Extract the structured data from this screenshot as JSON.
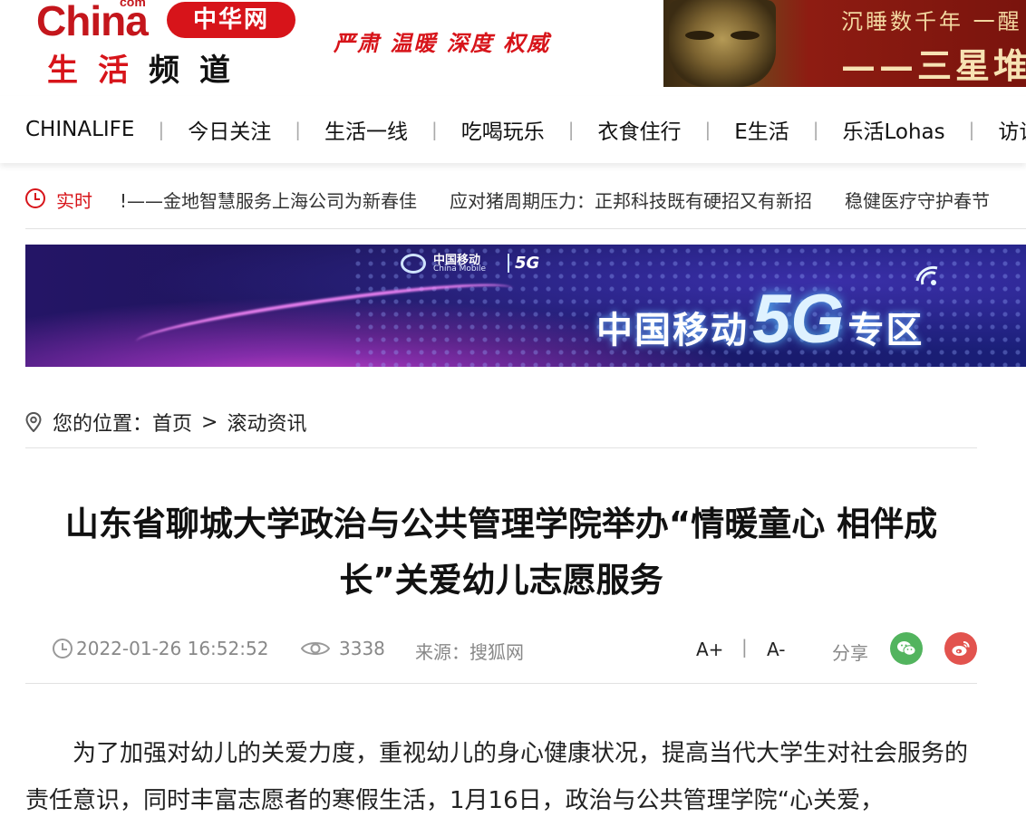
{
  "header": {
    "logo_china": "China",
    "logo_com": "com",
    "logo_badge": "中华网",
    "logo_channel": [
      "生",
      "活",
      "频",
      "道"
    ],
    "slogan": "严肃 温暖 深度 权威",
    "banner_line1": "沉睡数千年 一醒",
    "banner_line2": "——三星堆"
  },
  "nav": {
    "items": [
      "CHINALIFE",
      "今日关注",
      "生活一线",
      "吃喝玩乐",
      "衣食住行",
      "E生活",
      "乐活Lohas",
      "访谈"
    ],
    "separator": "|"
  },
  "ticker": {
    "label": "实时",
    "items": [
      "!——金地智慧服务上海公司为新春佳",
      "应对猪周期压力：正邦科技既有硬招又有新招",
      "稳健医疗守护春节"
    ]
  },
  "promo": {
    "logo_cn": "中国移动",
    "logo_en": "China Mobile",
    "logo_badge": "5G",
    "title_prefix": "中国移动",
    "title_5g": "5G",
    "title_suffix": "专区"
  },
  "breadcrumb": {
    "prefix": "您的位置：",
    "home": "首页",
    "separator": ">",
    "current": "滚动资讯"
  },
  "article": {
    "title": "山东省聊城大学政治与公共管理学院举办“情暖童心 相伴成长”关爱幼儿志愿服务",
    "datetime": "2022-01-26 16:52:52",
    "views": "3338",
    "source": "来源：搜狐网",
    "font_up": "A+",
    "font_sep": "|",
    "font_down": "A-",
    "share_label": "分享",
    "body": "为了加强对幼儿的关爱力度，重视幼儿的身心健康状况，提高当代大学生对社会服务的责任意识，同时丰富志愿者的寒假生活，1月16日，政治与公共管理学院“心关爱，"
  },
  "colors": {
    "brand_red": "#d7141a",
    "wechat_green": "#52b45e",
    "weibo_red": "#e2534e",
    "meta_gray": "#888888"
  },
  "icons": [
    "clock-icon",
    "location-pin-icon",
    "eye-icon",
    "wechat-icon",
    "weibo-icon",
    "wifi-icon"
  ]
}
